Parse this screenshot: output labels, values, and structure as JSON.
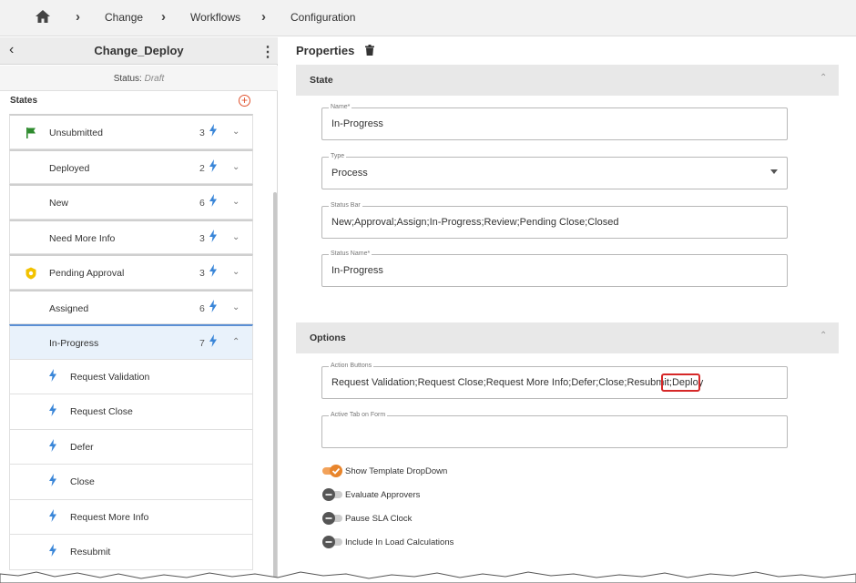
{
  "breadcrumb": {
    "items": [
      "Change",
      "Workflows",
      "Configuration"
    ]
  },
  "left_panel": {
    "title": "Change_Deploy",
    "status_label": "Status:",
    "status_value": "Draft",
    "states_label": "States",
    "states": [
      {
        "label": "Unsubmitted",
        "count": "3",
        "icon": "flag-icon"
      },
      {
        "label": "Deployed",
        "count": "2",
        "icon": ""
      },
      {
        "label": "New",
        "count": "6",
        "icon": ""
      },
      {
        "label": "Need More Info",
        "count": "3",
        "icon": ""
      },
      {
        "label": "Pending Approval",
        "count": "3",
        "icon": "approval-badge-icon"
      },
      {
        "label": "Assigned",
        "count": "6",
        "icon": ""
      },
      {
        "label": "In-Progress",
        "count": "7",
        "icon": "",
        "expanded": true
      }
    ],
    "actions": [
      "Request Validation",
      "Request Close",
      "Defer",
      "Close",
      "Request More Info",
      "Resubmit"
    ]
  },
  "properties": {
    "title": "Properties",
    "state_section": "State",
    "options_section": "Options",
    "name": {
      "label": "Name*",
      "value": "In-Progress"
    },
    "type": {
      "label": "Type",
      "value": "Process"
    },
    "status_bar": {
      "label": "Status Bar",
      "value": "New;Approval;Assign;In-Progress;Review;Pending Close;Closed"
    },
    "status_name": {
      "label": "Status Name*",
      "value": "In-Progress"
    },
    "action_buttons": {
      "label": "Action Buttons",
      "value": "Request Validation;Request Close;Request More Info;Defer;Close;Resubmit;Deploy"
    },
    "active_tab": {
      "label": "Active Tab on Form",
      "value": ""
    },
    "toggles": [
      {
        "label": "Show Template DropDown",
        "on": true
      },
      {
        "label": "Evaluate Approvers",
        "on": false
      },
      {
        "label": "Pause SLA Clock",
        "on": false
      },
      {
        "label": "Include In Load Calculations",
        "on": false
      }
    ]
  },
  "colors": {
    "bolt": "#3a86d8",
    "accent_orange": "#e8852c",
    "highlight_red": "#d62828",
    "selected_row": "#e9f2fb"
  }
}
